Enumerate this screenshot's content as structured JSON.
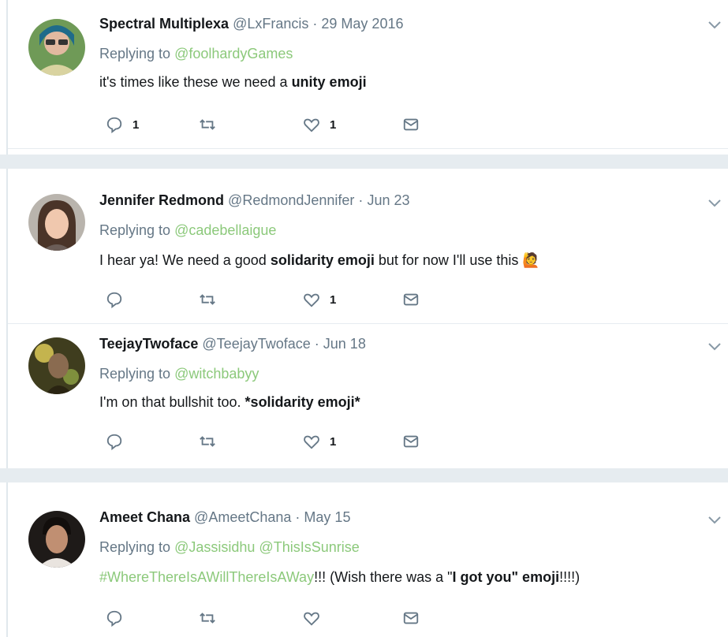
{
  "tweets": [
    {
      "name": "Spectral Multiplexa",
      "handle": "@LxFrancis",
      "dot": "·",
      "date": "29 May 2016",
      "replying_label": "Replying to",
      "mentions": [
        "@foolhardyGames"
      ],
      "text_before": "it's times like these we need a ",
      "text_bold": "unity emoji",
      "text_after": "",
      "replies": "1",
      "retweets": "",
      "likes": "1",
      "avatar_color": "#7fa86a"
    },
    {
      "name": "Jennifer Redmond",
      "handle": "@RedmondJennifer",
      "dot": "·",
      "date": "Jun 23",
      "replying_label": "Replying to",
      "mentions": [
        "@cadebellaigue"
      ],
      "text_before": "I hear ya! We need a good ",
      "text_bold": "solidarity emoji",
      "text_after": " but for now I'll use this 🙋",
      "replies": "",
      "retweets": "",
      "likes": "1",
      "avatar_color": "#c9a58c"
    },
    {
      "name": "TeejayTwoface",
      "handle": "@TeejayTwoface",
      "dot": "·",
      "date": "Jun 18",
      "replying_label": "Replying to",
      "mentions": [
        "@witchbabyy"
      ],
      "text_before": "I'm on that bullshit too. ",
      "text_bold": "*solidarity emoji*",
      "text_after": "",
      "replies": "",
      "retweets": "",
      "likes": "1",
      "avatar_color": "#6b6a3a"
    },
    {
      "name": "Ameet Chana",
      "handle": "@AmeetChana",
      "dot": "·",
      "date": "May 15",
      "replying_label": "Replying to",
      "mentions": [
        "@Jassisidhu",
        "@ThisIsSunrise"
      ],
      "hashtag": "#WhereThereIsAWillThereIsAWay",
      "text_before": "!!! (Wish there was a \"",
      "text_bold": "I got you\" emoji",
      "text_after": "!!!!)",
      "replies": "",
      "retweets": "",
      "likes": "",
      "avatar_color": "#3a2a22"
    }
  ],
  "icons": {
    "reply": "reply-icon",
    "retweet": "retweet-icon",
    "like": "heart-icon",
    "dm": "envelope-icon",
    "menu": "chevron-down-icon"
  },
  "colors": {
    "mention": "#8cc97b",
    "meta": "#657786",
    "gap": "#e6ecf0"
  }
}
